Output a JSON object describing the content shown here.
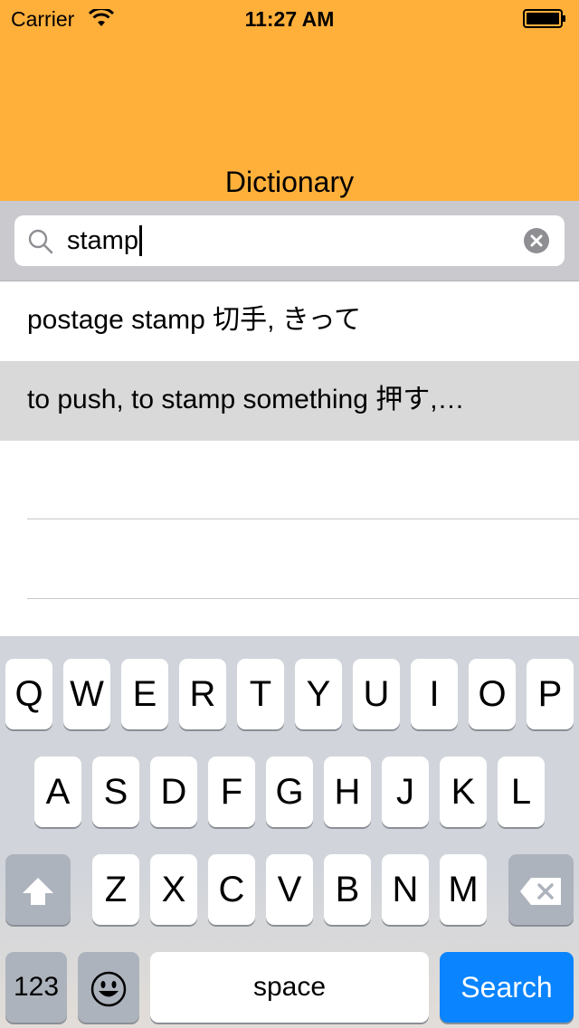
{
  "status_bar": {
    "carrier": "Carrier",
    "time": "11:27 AM"
  },
  "header": {
    "title": "Dictionary",
    "color": "#FFB03B"
  },
  "search": {
    "value": "stamp",
    "icon": "magnifier-icon",
    "clear_icon": "clear-circle-icon"
  },
  "results": [
    {
      "text": "postage stamp 切手, きって",
      "highlighted": false
    },
    {
      "text": "to push, to stamp something 押す,…",
      "highlighted": true
    }
  ],
  "keyboard": {
    "row1": [
      "Q",
      "W",
      "E",
      "R",
      "T",
      "Y",
      "U",
      "I",
      "O",
      "P"
    ],
    "row2": [
      "A",
      "S",
      "D",
      "F",
      "G",
      "H",
      "J",
      "K",
      "L"
    ],
    "row3": [
      "Z",
      "X",
      "C",
      "V",
      "B",
      "N",
      "M"
    ],
    "numbers_label": "123",
    "space_label": "space",
    "search_label": "Search",
    "shift_icon": "shift-arrow-icon",
    "delete_icon": "backspace-icon",
    "emoji_icon": "emoji-face-icon",
    "accent_color": "#0A84FF"
  }
}
